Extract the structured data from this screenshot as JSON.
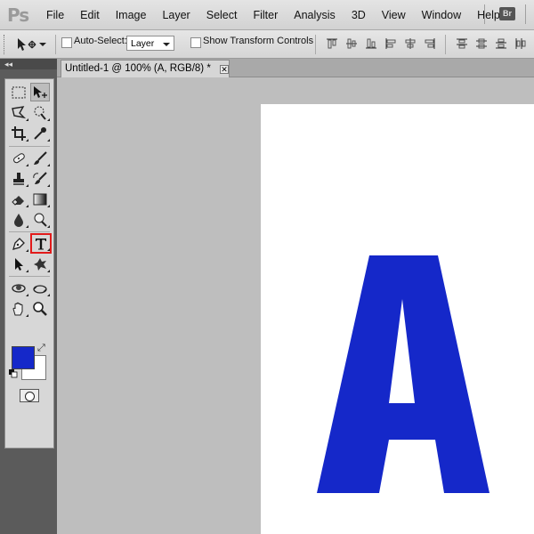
{
  "menubar": {
    "logo": "Ps",
    "items": [
      "File",
      "Edit",
      "Image",
      "Layer",
      "Select",
      "Filter",
      "Analysis",
      "3D",
      "View",
      "Window",
      "Help"
    ],
    "bridge_label": "Br"
  },
  "options": {
    "auto_select_label": "Auto-Select:",
    "auto_select_checked": false,
    "auto_select_target": "Layer",
    "show_transform_label": "Show Transform Controls",
    "show_transform_checked": false
  },
  "toolbox": {
    "collapse_glyph": "◂◂",
    "foreground_color": "#1528c9",
    "background_color": "#ffffff",
    "highlighted_tool": "type-tool"
  },
  "document": {
    "tab_title": "Untitled-1 @ 100% (A, RGB/8) *",
    "close_glyph": "✕",
    "canvas_text": "A",
    "text_color": "#1528c9"
  }
}
